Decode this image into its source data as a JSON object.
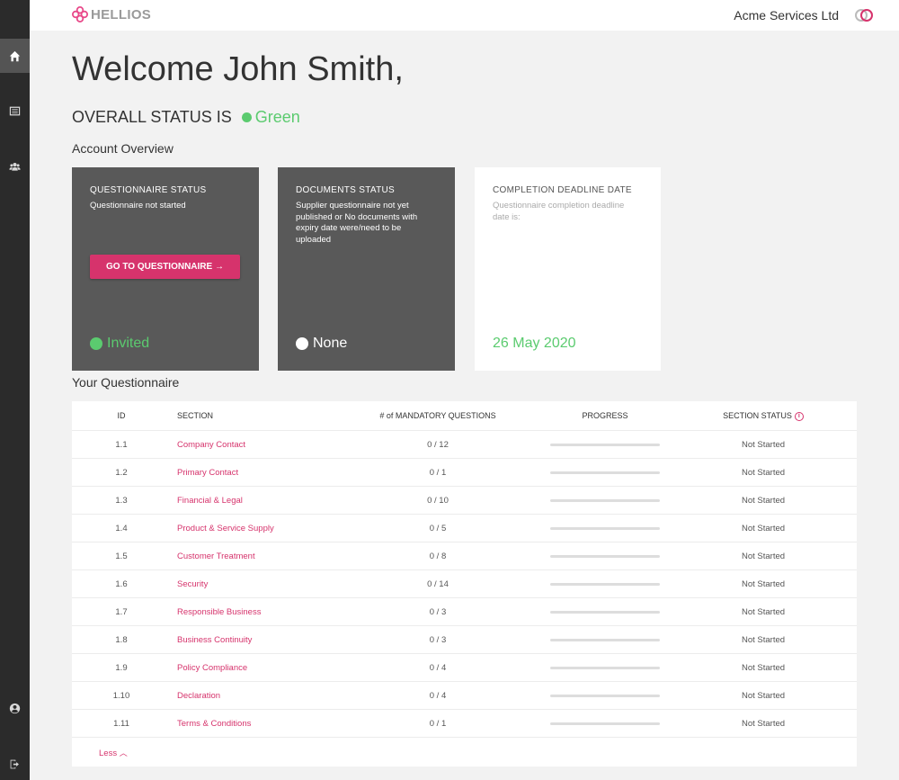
{
  "app": {
    "logo_text": "HELLIOS",
    "company_name": "Acme Services Ltd",
    "accent_color": "#d6336c",
    "status_green": "#5bcb6f"
  },
  "sidebar": {
    "items": [
      {
        "icon": "home-icon",
        "active": true
      },
      {
        "icon": "list-icon",
        "active": false
      },
      {
        "icon": "users-icon",
        "active": false
      },
      {
        "icon": "account-icon",
        "active": false
      },
      {
        "icon": "logout-icon",
        "active": false
      }
    ]
  },
  "page": {
    "welcome": "Welcome John Smith,",
    "overall_label": "OVERALL STATUS IS",
    "overall_value": "Green",
    "account_overview_heading": "Account Overview",
    "questionnaire_heading": "Your  Questionnaire"
  },
  "cards": {
    "questionnaire": {
      "title": "QUESTIONNAIRE STATUS",
      "description": "Questionnaire not started",
      "button_label": "GO TO QUESTIONNAIRE →",
      "status": "Invited",
      "status_color": "#5bcb6f"
    },
    "documents": {
      "title": "DOCUMENTS STATUS",
      "description": "Supplier questionnaire not yet published or No documents with expiry date were/need to be uploaded",
      "status": "None",
      "status_color": "#ffffff"
    },
    "deadline": {
      "title": "COMPLETION DEADLINE DATE",
      "description": "Questionnaire completion deadline date is:",
      "date": "26 May 2020"
    }
  },
  "table": {
    "headers": {
      "id": "ID",
      "section": "SECTION",
      "mandatory": "# of MANDATORY QUESTIONS",
      "progress": "PROGRESS",
      "status": "SECTION STATUS"
    },
    "rows": [
      {
        "id": "1.1",
        "section": "Company Contact",
        "mandatory": "0 / 12",
        "progress": 0,
        "status": "Not Started"
      },
      {
        "id": "1.2",
        "section": "Primary Contact",
        "mandatory": "0 / 1",
        "progress": 0,
        "status": "Not Started"
      },
      {
        "id": "1.3",
        "section": "Financial & Legal",
        "mandatory": "0 / 10",
        "progress": 0,
        "status": "Not Started"
      },
      {
        "id": "1.4",
        "section": "Product & Service Supply",
        "mandatory": "0 / 5",
        "progress": 0,
        "status": "Not Started"
      },
      {
        "id": "1.5",
        "section": "Customer Treatment",
        "mandatory": "0 / 8",
        "progress": 0,
        "status": "Not Started"
      },
      {
        "id": "1.6",
        "section": "Security",
        "mandatory": "0 / 14",
        "progress": 0,
        "status": "Not Started"
      },
      {
        "id": "1.7",
        "section": "Responsible Business",
        "mandatory": "0 / 3",
        "progress": 0,
        "status": "Not Started"
      },
      {
        "id": "1.8",
        "section": "Business Continuity",
        "mandatory": "0 / 3",
        "progress": 0,
        "status": "Not Started"
      },
      {
        "id": "1.9",
        "section": "Policy Compliance",
        "mandatory": "0 / 4",
        "progress": 0,
        "status": "Not Started"
      },
      {
        "id": "1.10",
        "section": "Declaration",
        "mandatory": "0 / 4",
        "progress": 0,
        "status": "Not Started"
      },
      {
        "id": "1.11",
        "section": "Terms & Conditions",
        "mandatory": "0 / 1",
        "progress": 0,
        "status": "Not Started"
      }
    ],
    "less_label": "Less"
  }
}
